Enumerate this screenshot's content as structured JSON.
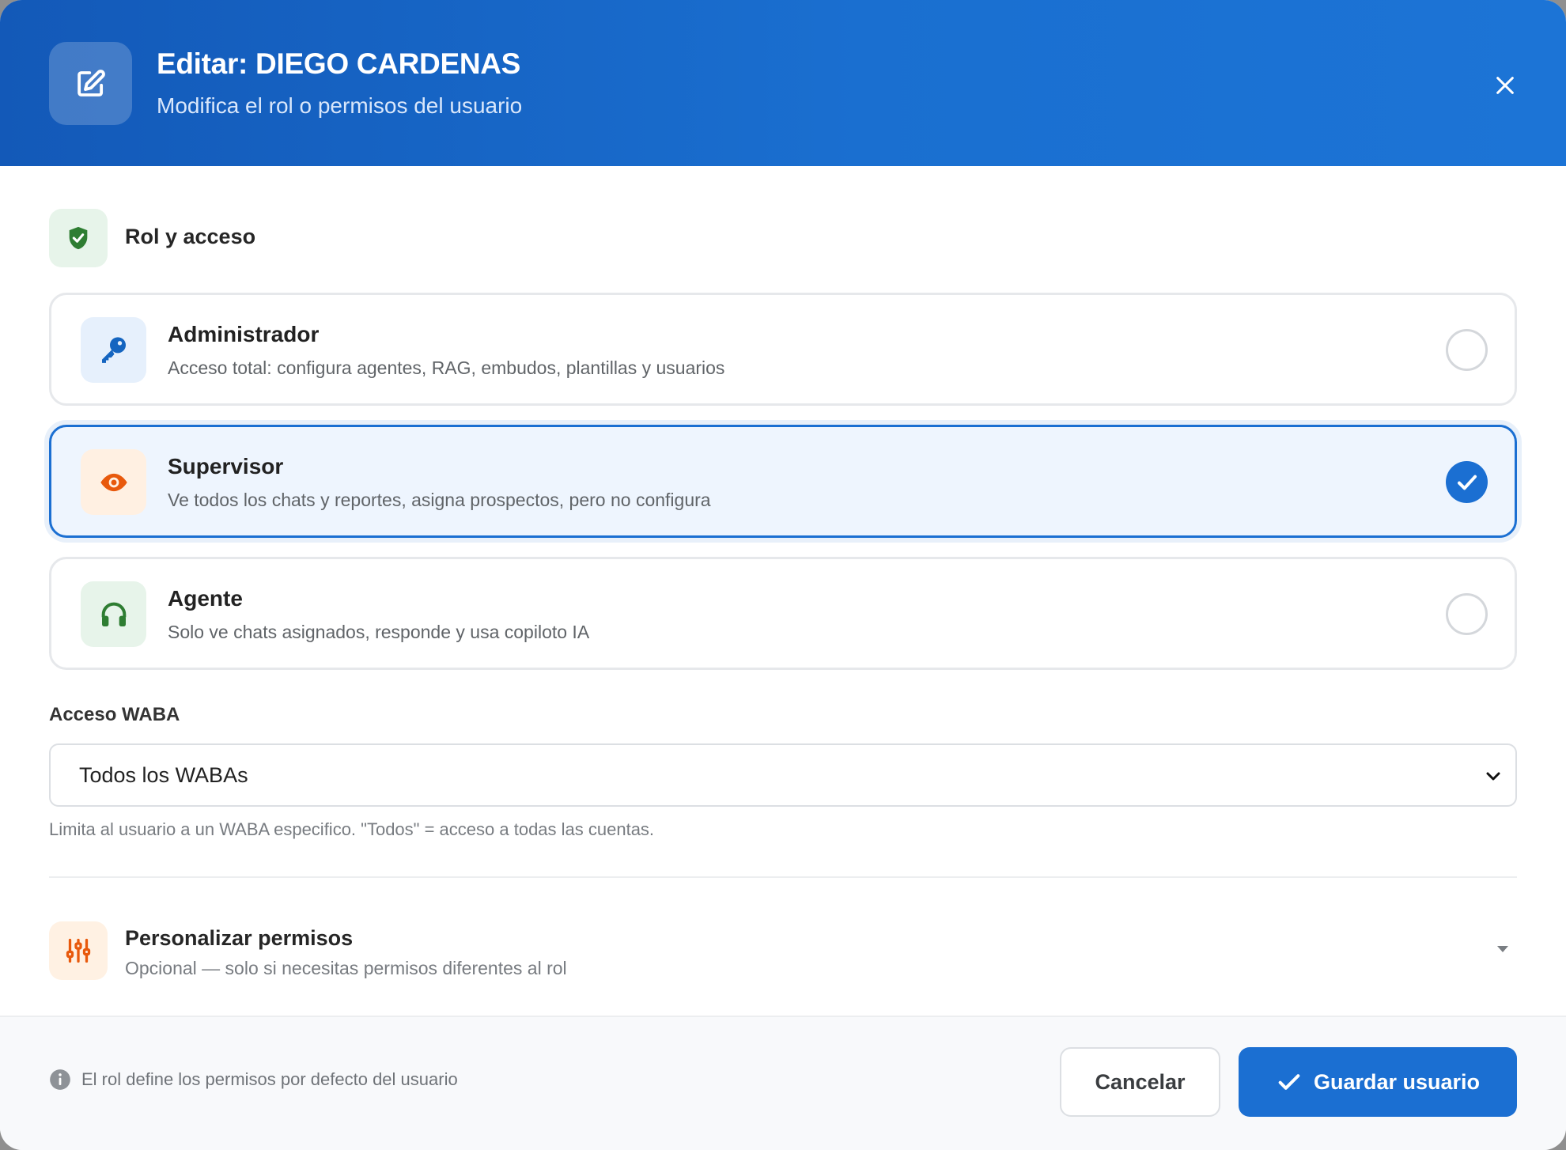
{
  "header": {
    "title": "Editar: DIEGO CARDENAS",
    "subtitle": "Modifica el rol o permisos del usuario",
    "edit_icon": "edit-square-icon",
    "close_icon": "close-icon"
  },
  "section": {
    "title": "Rol y acceso",
    "icon": "shield-check-icon"
  },
  "roles": [
    {
      "name": "Administrador",
      "description": "Acceso total: configura agentes, RAG, embudos, plantillas y usuarios",
      "icon": "key-icon",
      "selected": false
    },
    {
      "name": "Supervisor",
      "description": "Ve todos los chats y reportes, asigna prospectos, pero no configura",
      "icon": "eye-icon",
      "selected": true
    },
    {
      "name": "Agente",
      "description": "Solo ve chats asignados, responde y usa copiloto IA",
      "icon": "headset-icon",
      "selected": false
    }
  ],
  "waba": {
    "label": "Acceso WABA",
    "selected_value": "Todos los WABAs",
    "help": "Limita al usuario a un WABA especifico. \"Todos\" = acceso a todas las cuentas."
  },
  "customize": {
    "title": "Personalizar permisos",
    "description": "Opcional — solo si necesitas permisos diferentes al rol",
    "icon": "sliders-icon"
  },
  "footer": {
    "note": "El rol define los permisos por defecto del usuario",
    "cancel_label": "Cancelar",
    "save_label": "Guardar usuario"
  },
  "colors": {
    "primary": "#1b6fd2",
    "header_start": "#1359b8",
    "header_end": "#1c74d6",
    "admin_icon": "#1565c0",
    "supervisor_icon": "#e8590c",
    "agent_icon": "#2e7d32",
    "customize_icon": "#e8590c"
  }
}
